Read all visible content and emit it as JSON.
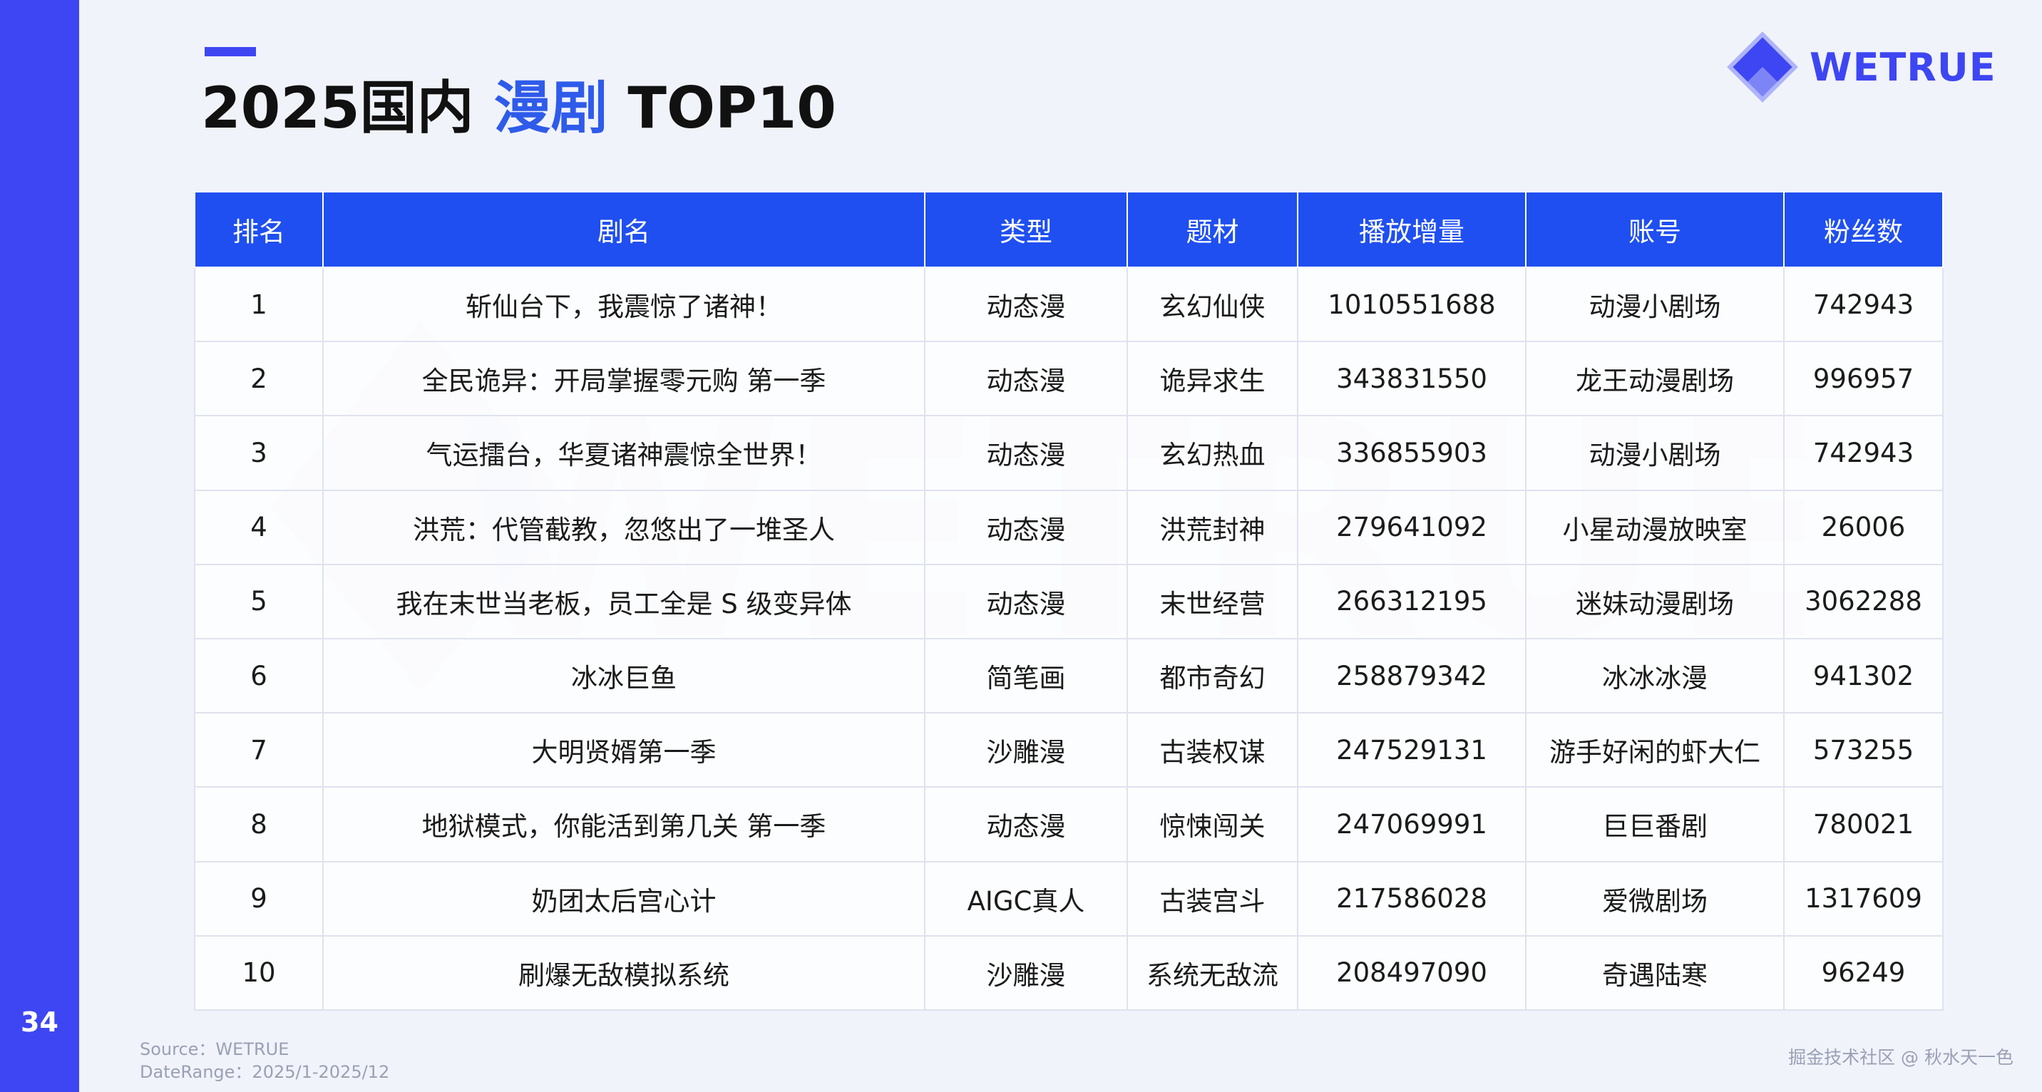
{
  "page_number": "34",
  "title": {
    "prefix": "2025国内 ",
    "highlight": "漫剧",
    "suffix": " TOP10"
  },
  "logo": {
    "text": "WETRUE",
    "icon": "wetrue-diamond-logo-icon",
    "color": "#3d46f2"
  },
  "watermark_text": "WETRUE",
  "table": {
    "headers": [
      "排名",
      "剧名",
      "类型",
      "题材",
      "播放增量",
      "账号",
      "粉丝数"
    ],
    "rows": [
      [
        "1",
        "斩仙台下，我震惊了诸神！",
        "动态漫",
        "玄幻仙侠",
        "1010551688",
        "动漫小剧场",
        "742943"
      ],
      [
        "2",
        "全民诡异：开局掌握零元购 第一季",
        "动态漫",
        "诡异求生",
        "343831550",
        "龙王动漫剧场",
        "996957"
      ],
      [
        "3",
        "气运擂台，华夏诸神震惊全世界！",
        "动态漫",
        "玄幻热血",
        "336855903",
        "动漫小剧场",
        "742943"
      ],
      [
        "4",
        "洪荒：代管截教，忽悠出了一堆圣人",
        "动态漫",
        "洪荒封神",
        "279641092",
        "小星动漫放映室",
        "26006"
      ],
      [
        "5",
        "我在末世当老板，员工全是 S 级变异体",
        "动态漫",
        "末世经营",
        "266312195",
        "迷妹动漫剧场",
        "3062288"
      ],
      [
        "6",
        "冰冰巨鱼",
        "简笔画",
        "都市奇幻",
        "258879342",
        "冰冰冰漫",
        "941302"
      ],
      [
        "7",
        "大明贤婿第一季",
        "沙雕漫",
        "古装权谋",
        "247529131",
        "游手好闲的虾大仁",
        "573255"
      ],
      [
        "8",
        "地狱模式，你能活到第几关 第一季",
        "动态漫",
        "惊悚闯关",
        "247069991",
        "巨巨番剧",
        "780021"
      ],
      [
        "9",
        "奶团太后宫心计",
        "AIGC真人",
        "古装宫斗",
        "217586028",
        "爱微剧场",
        "1317609"
      ],
      [
        "10",
        "刷爆无敌模拟系统",
        "沙雕漫",
        "系统无敌流",
        "208497090",
        "奇遇陆寒",
        "96249"
      ]
    ]
  },
  "footer": {
    "source": "Source：WETRUE",
    "date_range": "DateRange：2025/1-2025/12",
    "credit": "掘金技术社区 @ 秋水天一色"
  },
  "colors": {
    "accent": "#3d46f2",
    "header_bg": "#1f4ff0",
    "title_highlight": "#2f5bea",
    "background": "#f1f3fb"
  }
}
